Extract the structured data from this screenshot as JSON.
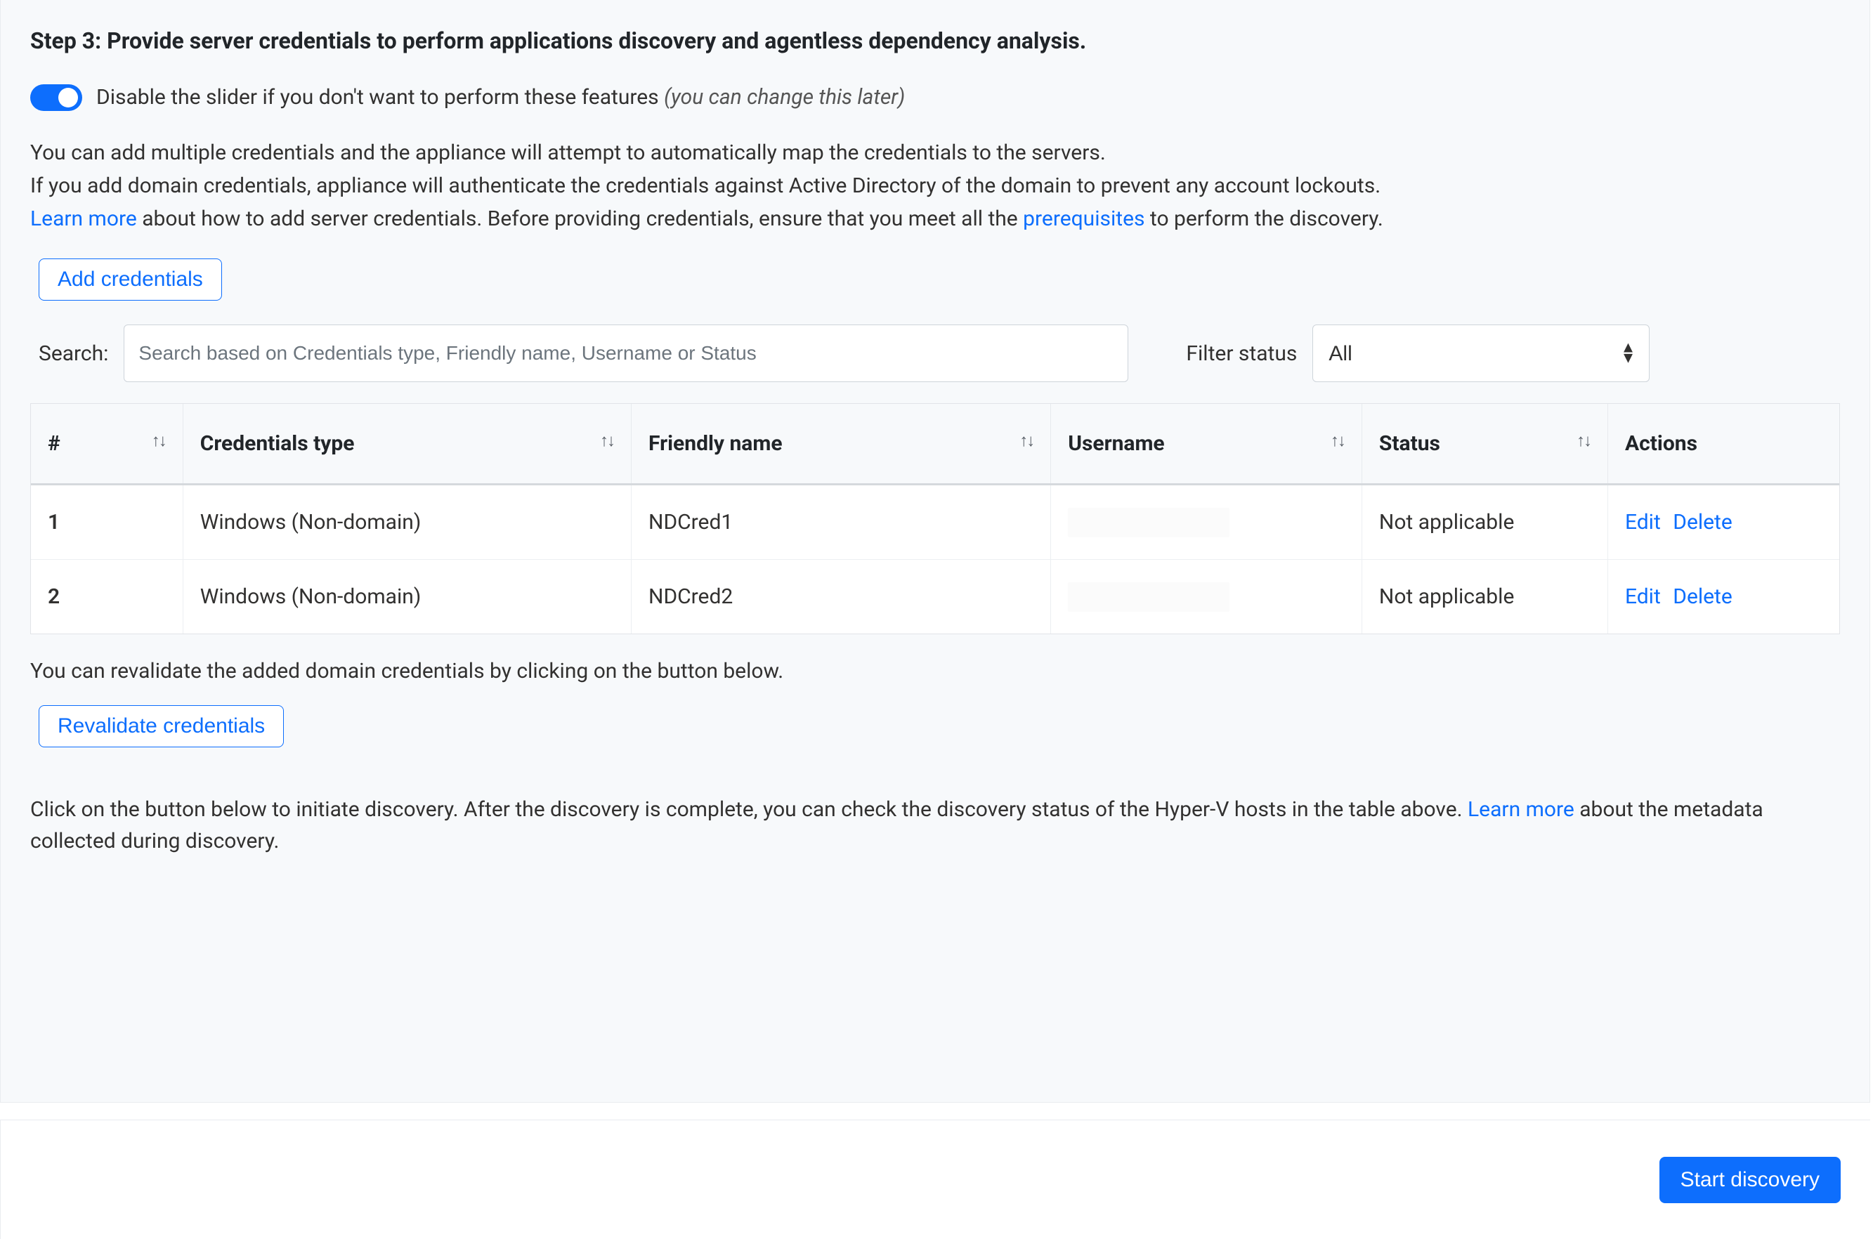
{
  "step": {
    "title": "Step 3: Provide server credentials to perform applications discovery and agentless dependency analysis."
  },
  "toggle": {
    "label_plain": "Disable the slider if you don't want to perform these features ",
    "label_italic": "(you can change this later)"
  },
  "description": {
    "line1": "You can add multiple credentials and the appliance will attempt to automatically map the credentials to the servers.",
    "line2": "If you add domain credentials, appliance will authenticate the credentials against Active Directory of the domain to prevent any account lockouts.",
    "learn_more": "Learn more",
    "line3_mid": " about how to add server credentials. Before providing credentials, ensure that you meet all the ",
    "prereq": "prerequisites",
    "line3_end": " to perform the discovery."
  },
  "buttons": {
    "add_credentials": "Add credentials",
    "revalidate": "Revalidate credentials",
    "start_discovery": "Start discovery"
  },
  "search": {
    "label": "Search:",
    "placeholder": "Search based on Credentials type, Friendly name, Username or Status"
  },
  "filter": {
    "label": "Filter status",
    "selected": "All",
    "options": [
      "All"
    ]
  },
  "table": {
    "headers": {
      "index": "#",
      "type": "Credentials type",
      "name": "Friendly name",
      "user": "Username",
      "status": "Status",
      "actions": "Actions"
    },
    "rows": [
      {
        "index": "1",
        "type": "Windows (Non-domain)",
        "name": "NDCred1",
        "user": "",
        "status": "Not applicable"
      },
      {
        "index": "2",
        "type": "Windows (Non-domain)",
        "name": "NDCred2",
        "user": "",
        "status": "Not applicable"
      }
    ],
    "actions": {
      "edit": "Edit",
      "delete": "Delete"
    }
  },
  "revalidate_info": "You can revalidate the added domain credentials by clicking on the button below.",
  "discovery_info": {
    "pre": "Click on the button below to initiate discovery. After the discovery is complete, you can check the discovery status of the Hyper-V hosts in the table above. ",
    "learn_more": "Learn more",
    "post": " about the metadata collected during discovery."
  }
}
